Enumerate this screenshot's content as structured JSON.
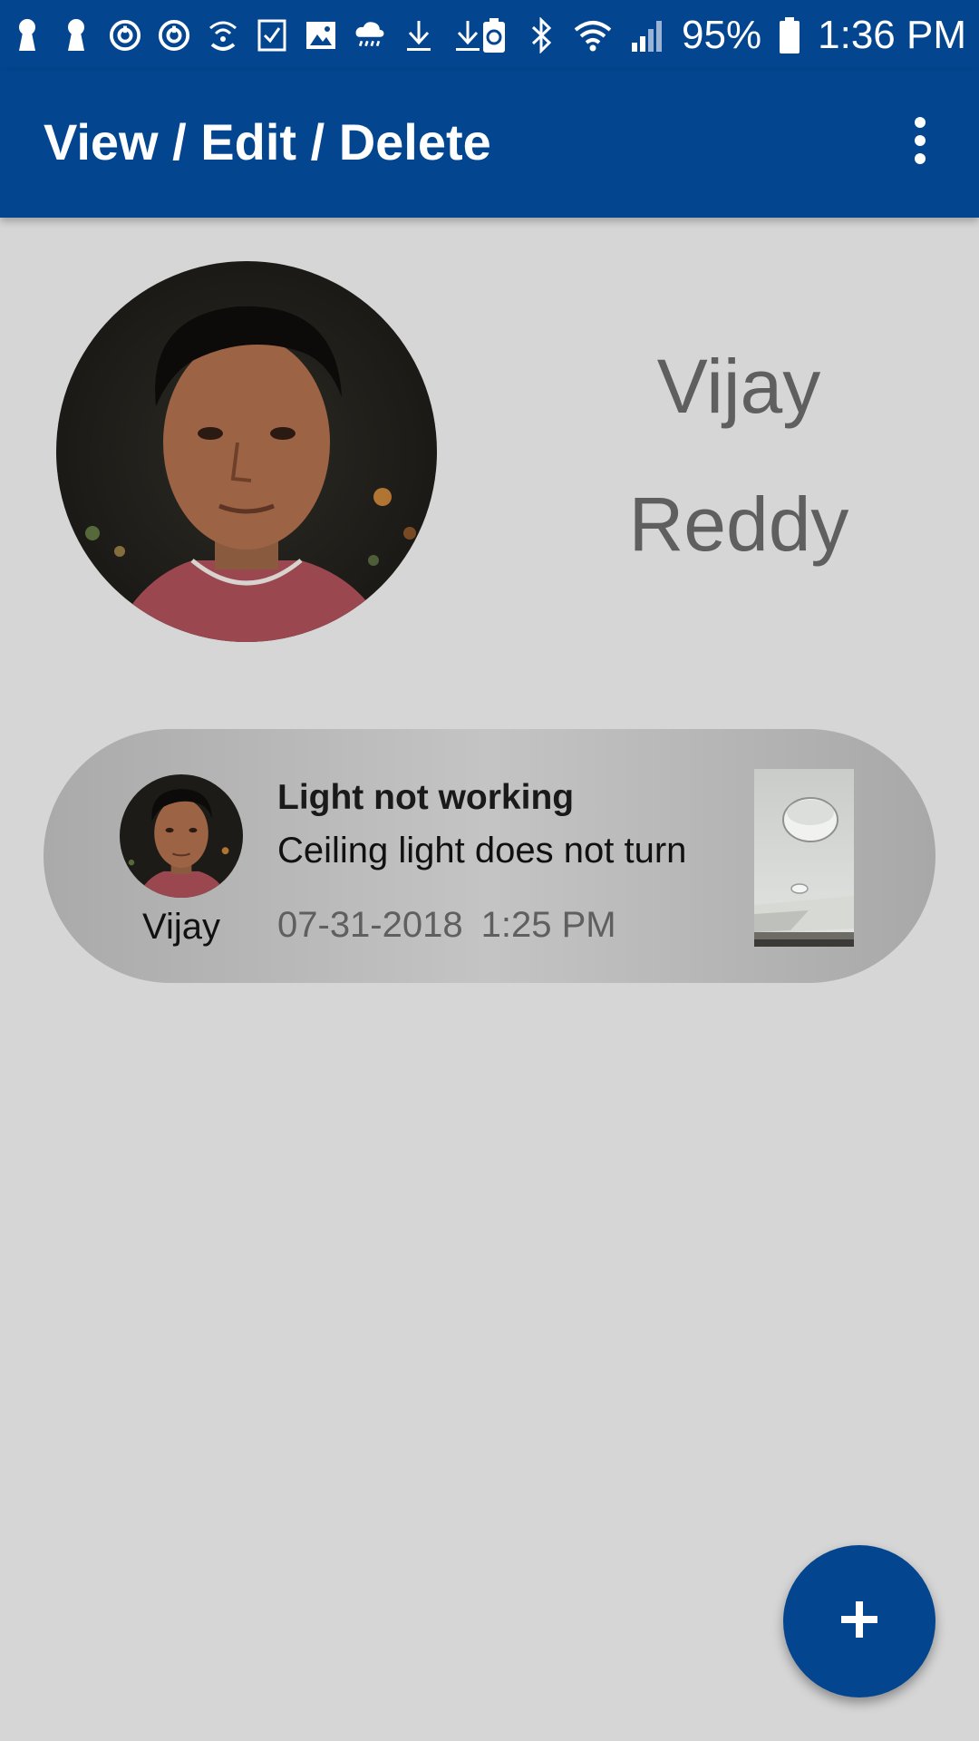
{
  "status_bar": {
    "left_icons": [
      "keyhole-icon",
      "keyhole-icon",
      "sync-icon",
      "sync-icon",
      "wifi-calling-icon",
      "checkbox-icon",
      "image-icon",
      "rain-cloud-icon",
      "download-icon",
      "download-icon"
    ],
    "right_icons": [
      "battery-saver-icon",
      "bluetooth-icon",
      "wifi-icon",
      "signal-icon",
      "battery-icon"
    ],
    "battery_percent": "95%",
    "time": "1:36 PM"
  },
  "app_bar": {
    "title": "View / Edit / Delete",
    "overflow_icon": "more-vert-icon",
    "color": "#03468f"
  },
  "profile": {
    "first_name": "Vijay",
    "last_name": "Reddy"
  },
  "tickets": [
    {
      "user": "Vijay",
      "title": "Light not working",
      "description": "Ceiling light does not turn",
      "date": "07-31-2018",
      "time": "1:25 PM"
    }
  ],
  "fab": {
    "icon": "add-icon",
    "label": "+"
  },
  "colors": {
    "primary": "#03468f",
    "background": "#d6d6d6",
    "name_text": "#5f5f5f"
  }
}
